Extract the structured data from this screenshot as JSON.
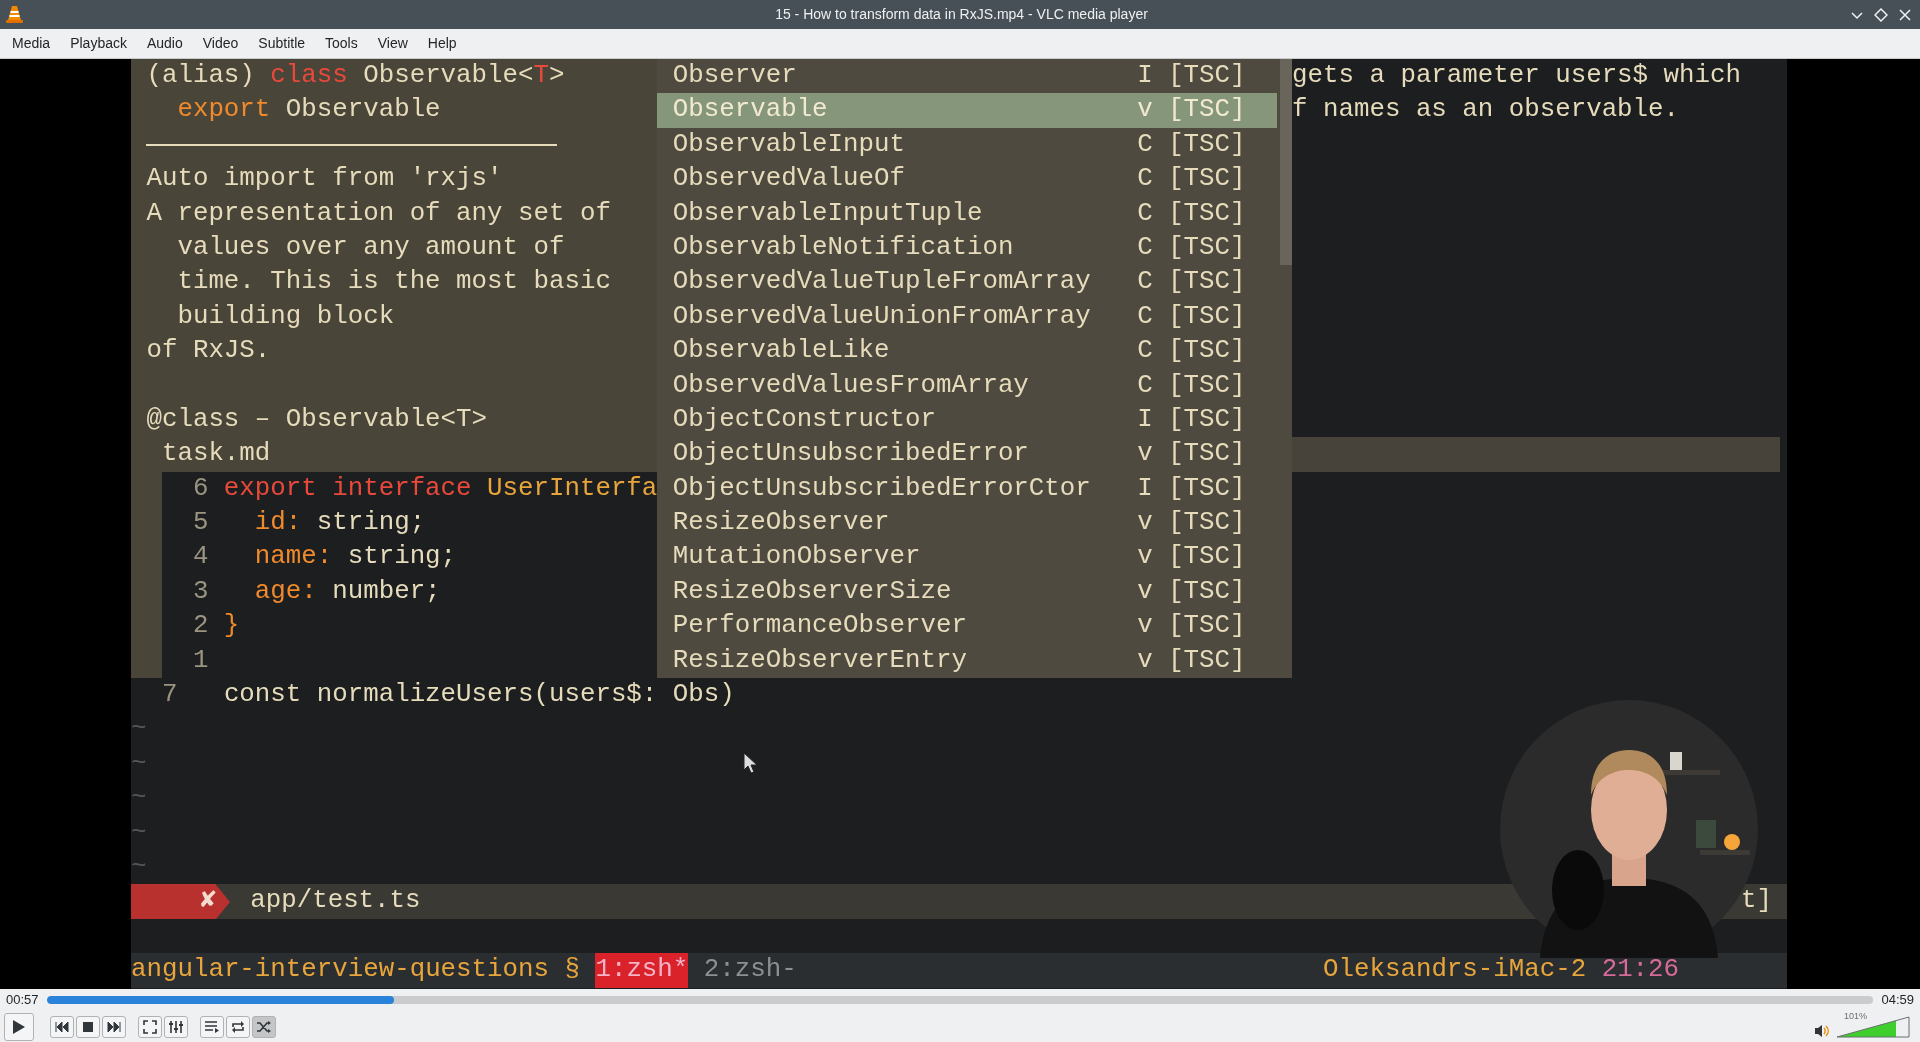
{
  "window": {
    "title": "15 - How to transform data in RxJS.mp4 - VLC media player"
  },
  "menu": [
    "Media",
    "Playback",
    "Audio",
    "Video",
    "Subtitle",
    "Tools",
    "View",
    "Help"
  ],
  "video": {
    "doc_lines": [
      {
        "kind": "text",
        "tokens": [
          {
            "text": "(alias) ",
            "kind": "plain"
          },
          {
            "text": "class ",
            "kind": "keyword"
          },
          {
            "text": "Observable<",
            "kind": "plain"
          },
          {
            "text": "T",
            "kind": "keyword"
          },
          {
            "text": ">",
            "kind": "plain"
          }
        ]
      },
      {
        "kind": "text",
        "tokens": [
          {
            "text": "  export ",
            "kind": "export"
          },
          {
            "text": "Observable",
            "kind": "plain"
          }
        ]
      },
      {
        "kind": "rule"
      },
      {
        "kind": "text",
        "tokens": [
          {
            "text": "Auto import from 'rxjs'",
            "kind": "plain"
          }
        ]
      },
      {
        "kind": "text",
        "tokens": [
          {
            "text": "A representation of any set of",
            "kind": "plain"
          }
        ]
      },
      {
        "kind": "text",
        "tokens": [
          {
            "text": "  values over any amount of",
            "kind": "plain"
          }
        ]
      },
      {
        "kind": "text",
        "tokens": [
          {
            "text": "  time. This is the most basic",
            "kind": "plain"
          }
        ]
      },
      {
        "kind": "text",
        "tokens": [
          {
            "text": "  building block",
            "kind": "plain"
          }
        ]
      },
      {
        "kind": "text",
        "tokens": [
          {
            "text": "of RxJS.",
            "kind": "plain"
          }
        ]
      },
      {
        "kind": "blank"
      },
      {
        "kind": "text",
        "tokens": [
          {
            "text": "@class – Observable<T>",
            "kind": "plain"
          }
        ]
      },
      {
        "kind": "text",
        "tokens": [
          {
            "text": " task.md",
            "kind": "plain"
          }
        ]
      }
    ],
    "code_lines": [
      {
        "number": "6",
        "tokens": [
          {
            "text": "export interface ",
            "kind": "keyword"
          },
          {
            "text": "UserInterfa",
            "kind": "type"
          }
        ]
      },
      {
        "number": "5",
        "tokens": [
          {
            "text": "  id:",
            "kind": "export"
          },
          {
            "text": " string;",
            "kind": "plain"
          }
        ]
      },
      {
        "number": "4",
        "tokens": [
          {
            "text": "  name:",
            "kind": "export"
          },
          {
            "text": " string;",
            "kind": "plain"
          }
        ]
      },
      {
        "number": "3",
        "tokens": [
          {
            "text": "  age:",
            "kind": "export"
          },
          {
            "text": " number;",
            "kind": "plain"
          }
        ]
      },
      {
        "number": "2",
        "tokens": [
          {
            "text": "}",
            "kind": "export"
          }
        ]
      },
      {
        "number": "1"
      }
    ],
    "current_line": {
      "number": "7",
      "tokens": [
        {
          "text": "const normalizeUsers(users$: Obs)",
          "kind": "plain"
        }
      ]
    },
    "completions": [
      {
        "label": "Observer",
        "type": "I",
        "source": "[TSC]",
        "selected": false
      },
      {
        "label": "Observable",
        "type": "v",
        "source": "[TSC]",
        "selected": true
      },
      {
        "label": "ObservableInput",
        "type": "C",
        "source": "[TSC]",
        "selected": false
      },
      {
        "label": "ObservedValueOf",
        "type": "C",
        "source": "[TSC]",
        "selected": false
      },
      {
        "label": "ObservableInputTuple",
        "type": "C",
        "source": "[TSC]",
        "selected": false
      },
      {
        "label": "ObservableNotification",
        "type": "C",
        "source": "[TSC]",
        "selected": false
      },
      {
        "label": "ObservedValueTupleFromArray",
        "type": "C",
        "source": "[TSC]",
        "selected": false
      },
      {
        "label": "ObservedValueUnionFromArray",
        "type": "C",
        "source": "[TSC]",
        "selected": false
      },
      {
        "label": "ObservableLike",
        "type": "C",
        "source": "[TSC]",
        "selected": false
      },
      {
        "label": "ObservedValuesFromArray",
        "type": "C",
        "source": "[TSC]",
        "selected": false
      },
      {
        "label": "ObjectConstructor",
        "type": "I",
        "source": "[TSC]",
        "selected": false
      },
      {
        "label": "ObjectUnsubscribedError",
        "type": "v",
        "source": "[TSC]",
        "selected": false
      },
      {
        "label": "ObjectUnsubscribedErrorCtor",
        "type": "I",
        "source": "[TSC]",
        "selected": false
      },
      {
        "label": "ResizeObserver",
        "type": "v",
        "source": "[TSC]",
        "selected": false
      },
      {
        "label": "MutationObserver",
        "type": "v",
        "source": "[TSC]",
        "selected": false
      },
      {
        "label": "ResizeObserverSize",
        "type": "v",
        "source": "[TSC]",
        "selected": false
      },
      {
        "label": "PerformanceObserver",
        "type": "v",
        "source": "[TSC]",
        "selected": false
      },
      {
        "label": "ResizeObserverEntry",
        "type": "v",
        "source": "[TSC]",
        "selected": false
      }
    ],
    "right_lines": [
      "gets a parameter users$ which",
      "f names as an observable."
    ],
    "tildes": [
      "~",
      "~",
      "~",
      "~",
      "~"
    ],
    "statusline": {
      "error_mark": "✘",
      "file": "app/test.ts",
      "right": "t]"
    },
    "tmux": {
      "session": "angular-interview-questions § ",
      "windows": [
        {
          "label": "1:zsh*",
          "selected": true
        },
        {
          "label": "2:zsh-",
          "selected": false
        }
      ],
      "host": "Oleksandrs-iMac-2",
      "time": "21:26"
    }
  },
  "player": {
    "elapsed": "00:57",
    "total": "04:59",
    "seek": {
      "level": 0.19
    },
    "loop": {
      "on": false
    },
    "random": {
      "on": true
    },
    "volume": {
      "label": "101%",
      "level": 0.81
    }
  }
}
